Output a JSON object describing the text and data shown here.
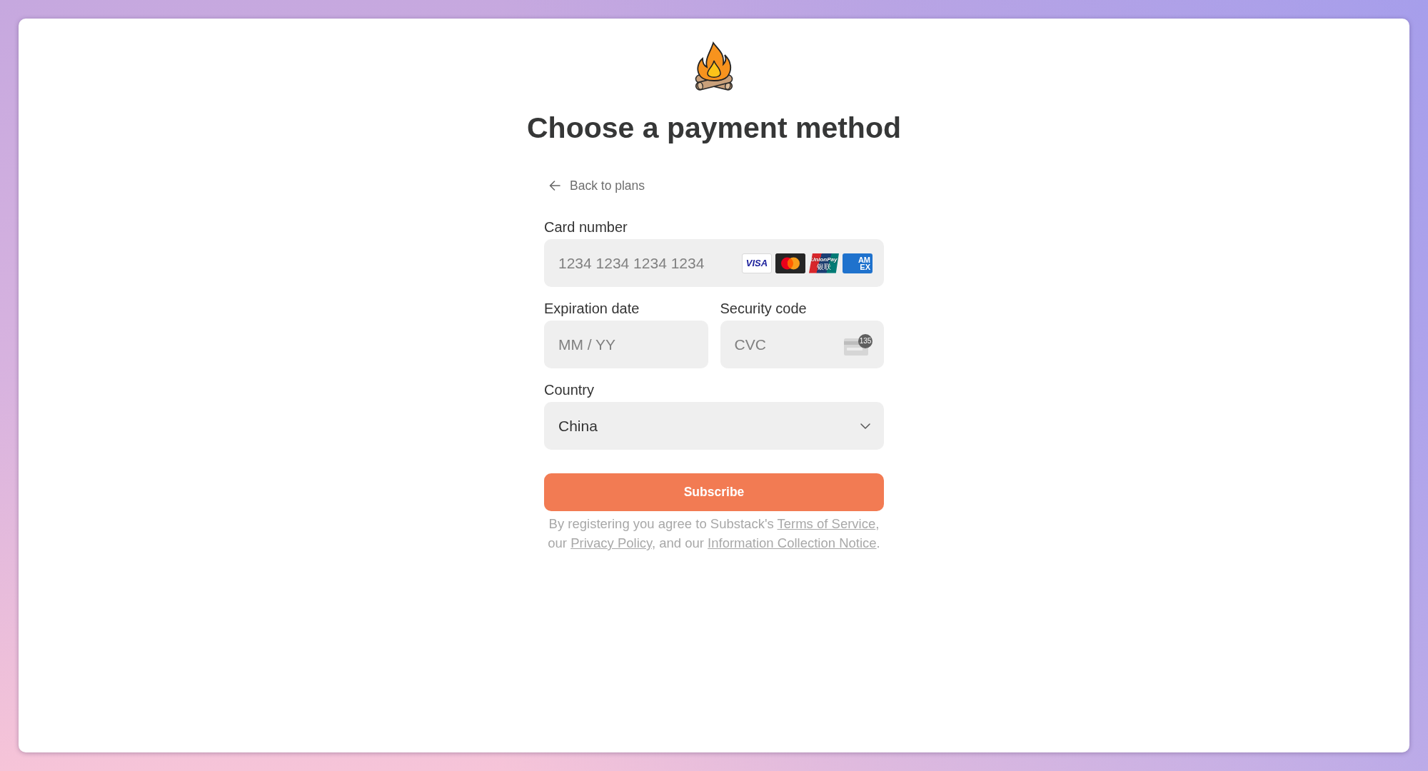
{
  "title": "Choose a payment method",
  "back_link": {
    "label": "Back to plans"
  },
  "card_number": {
    "label": "Card number",
    "placeholder": "1234 1234 1234 1234",
    "brands": [
      {
        "kind": "visa",
        "lines": [
          "VISA"
        ]
      },
      {
        "kind": "mastercard"
      },
      {
        "kind": "unionpay",
        "lines": [
          "UnionPay",
          "银联"
        ]
      },
      {
        "kind": "amex",
        "lines": [
          "AM",
          "EX"
        ]
      }
    ]
  },
  "expiration": {
    "label": "Expiration date",
    "placeholder": "MM / YY"
  },
  "security_code": {
    "label": "Security code",
    "placeholder": "CVC",
    "badge": "135"
  },
  "country": {
    "label": "Country",
    "value": "China"
  },
  "submit": {
    "label": "Subscribe"
  },
  "legal": [
    {
      "kind": "text",
      "text": "By registering you agree to Substack's "
    },
    {
      "kind": "link",
      "text": "Terms of Service"
    },
    {
      "kind": "text",
      "text": ", our "
    },
    {
      "kind": "link",
      "text": "Privacy Policy"
    },
    {
      "kind": "text",
      "text": ", and our "
    },
    {
      "kind": "link",
      "text": "Information Collection Notice"
    },
    {
      "kind": "text",
      "text": "."
    }
  ]
}
